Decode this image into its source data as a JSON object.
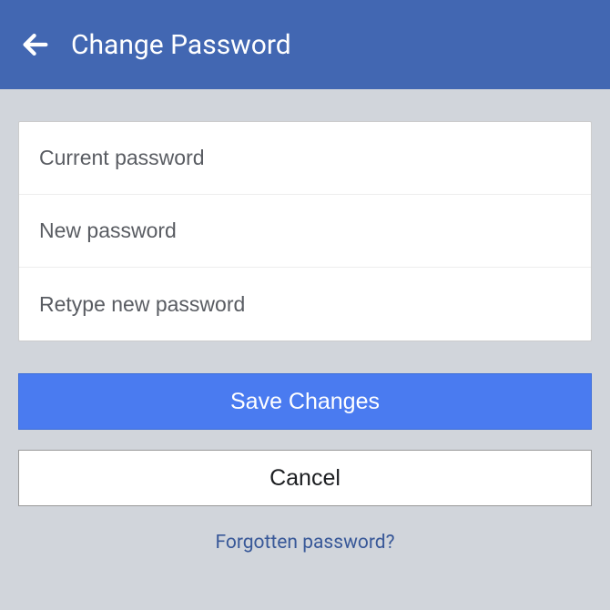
{
  "header": {
    "title": "Change Password"
  },
  "form": {
    "current_password_placeholder": "Current password",
    "new_password_placeholder": "New password",
    "retype_password_placeholder": "Retype new password",
    "current_password_value": "",
    "new_password_value": "",
    "retype_password_value": ""
  },
  "buttons": {
    "save_label": "Save Changes",
    "cancel_label": "Cancel"
  },
  "links": {
    "forgotten_label": "Forgotten password?"
  }
}
